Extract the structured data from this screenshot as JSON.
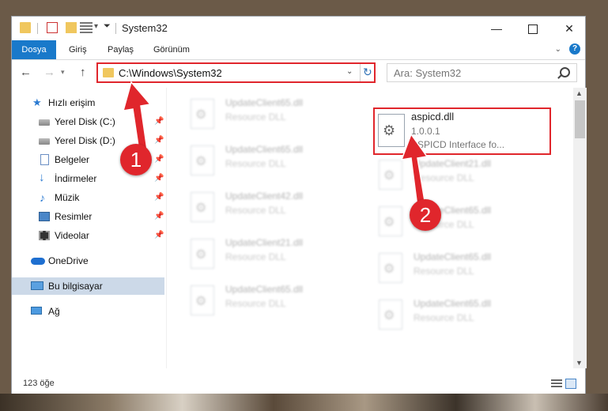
{
  "window": {
    "title": "System32",
    "controls": {
      "minimize": "—",
      "maximize": "",
      "close": "✕"
    }
  },
  "ribbon": {
    "tabs": [
      {
        "label": "Dosya",
        "active": true
      },
      {
        "label": "Giriş"
      },
      {
        "label": "Paylaş"
      },
      {
        "label": "Görünüm"
      }
    ],
    "help": "?"
  },
  "navigation": {
    "address": "C:\\Windows\\System32",
    "search_placeholder": "Ara: System32"
  },
  "sidebar": {
    "items": [
      {
        "label": "Hızlı erişim",
        "icon": "star-icon"
      },
      {
        "label": "Yerel Disk (C:)",
        "icon": "drive-icon",
        "pinned": true
      },
      {
        "label": "Yerel Disk (D:)",
        "icon": "drive-icon",
        "pinned": true
      },
      {
        "label": "Belgeler",
        "icon": "document-icon",
        "pinned": true
      },
      {
        "label": "İndirmeler",
        "icon": "download-icon",
        "pinned": true
      },
      {
        "label": "Müzik",
        "icon": "music-icon",
        "pinned": true
      },
      {
        "label": "Resimler",
        "icon": "pictures-icon",
        "pinned": true
      },
      {
        "label": "Videolar",
        "icon": "video-icon",
        "pinned": true
      },
      {
        "label": "OneDrive",
        "icon": "cloud-icon"
      },
      {
        "label": "Bu bilgisayar",
        "icon": "computer-icon",
        "selected": true
      },
      {
        "label": "Ağ",
        "icon": "network-icon"
      }
    ]
  },
  "files": {
    "highlighted": {
      "name": "aspicd.dll",
      "version": "1.0.0.1",
      "description": "ASPICD Interface fo..."
    },
    "column_left": [
      {
        "name": "UpdateClient65.dll",
        "type": "Resource DLL"
      },
      {
        "name": "UpdateClient65.dll",
        "type": "Resource DLL"
      },
      {
        "name": "UpdateClient42.dll",
        "type": "Resource DLL"
      },
      {
        "name": "UpdateClient21.dll",
        "type": "Resource DLL"
      },
      {
        "name": "UpdateClient65.dll",
        "type": "Resource DLL"
      }
    ],
    "column_right": [
      {
        "name": "UpdateClient21.dll",
        "type": "Resource DLL"
      },
      {
        "name": "UpdateClient65.dll",
        "type": "Resource DLL"
      },
      {
        "name": "UpdateClient65.dll",
        "type": "Resource DLL"
      },
      {
        "name": "UpdateClient65.dll",
        "type": "Resource DLL"
      }
    ]
  },
  "status": {
    "item_count": "123 öğe"
  },
  "annotations": {
    "step1": "1",
    "step2": "2",
    "color": "#e0262c"
  }
}
